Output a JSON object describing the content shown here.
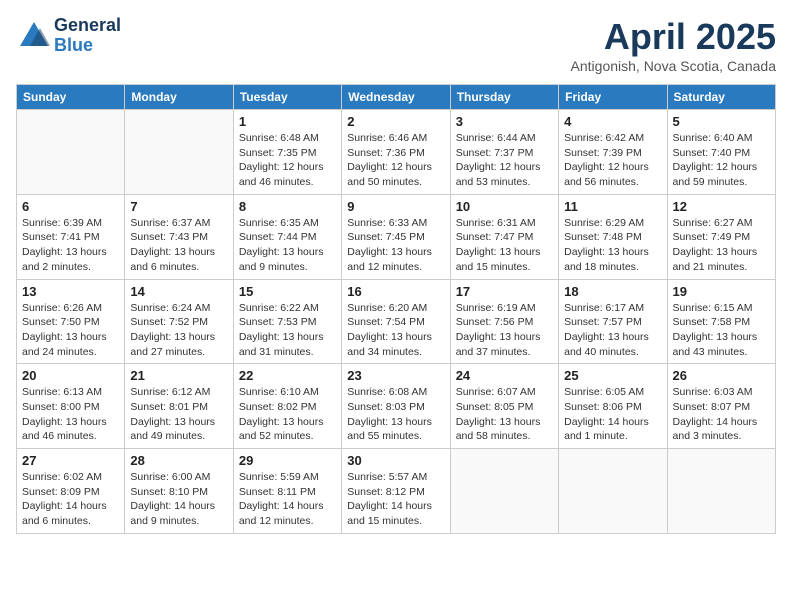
{
  "header": {
    "logo_general": "General",
    "logo_blue": "Blue",
    "month_year": "April 2025",
    "location": "Antigonish, Nova Scotia, Canada"
  },
  "weekdays": [
    "Sunday",
    "Monday",
    "Tuesday",
    "Wednesday",
    "Thursday",
    "Friday",
    "Saturday"
  ],
  "weeks": [
    [
      {
        "day": "",
        "info": ""
      },
      {
        "day": "",
        "info": ""
      },
      {
        "day": "1",
        "info": "Sunrise: 6:48 AM\nSunset: 7:35 PM\nDaylight: 12 hours and 46 minutes."
      },
      {
        "day": "2",
        "info": "Sunrise: 6:46 AM\nSunset: 7:36 PM\nDaylight: 12 hours and 50 minutes."
      },
      {
        "day": "3",
        "info": "Sunrise: 6:44 AM\nSunset: 7:37 PM\nDaylight: 12 hours and 53 minutes."
      },
      {
        "day": "4",
        "info": "Sunrise: 6:42 AM\nSunset: 7:39 PM\nDaylight: 12 hours and 56 minutes."
      },
      {
        "day": "5",
        "info": "Sunrise: 6:40 AM\nSunset: 7:40 PM\nDaylight: 12 hours and 59 minutes."
      }
    ],
    [
      {
        "day": "6",
        "info": "Sunrise: 6:39 AM\nSunset: 7:41 PM\nDaylight: 13 hours and 2 minutes."
      },
      {
        "day": "7",
        "info": "Sunrise: 6:37 AM\nSunset: 7:43 PM\nDaylight: 13 hours and 6 minutes."
      },
      {
        "day": "8",
        "info": "Sunrise: 6:35 AM\nSunset: 7:44 PM\nDaylight: 13 hours and 9 minutes."
      },
      {
        "day": "9",
        "info": "Sunrise: 6:33 AM\nSunset: 7:45 PM\nDaylight: 13 hours and 12 minutes."
      },
      {
        "day": "10",
        "info": "Sunrise: 6:31 AM\nSunset: 7:47 PM\nDaylight: 13 hours and 15 minutes."
      },
      {
        "day": "11",
        "info": "Sunrise: 6:29 AM\nSunset: 7:48 PM\nDaylight: 13 hours and 18 minutes."
      },
      {
        "day": "12",
        "info": "Sunrise: 6:27 AM\nSunset: 7:49 PM\nDaylight: 13 hours and 21 minutes."
      }
    ],
    [
      {
        "day": "13",
        "info": "Sunrise: 6:26 AM\nSunset: 7:50 PM\nDaylight: 13 hours and 24 minutes."
      },
      {
        "day": "14",
        "info": "Sunrise: 6:24 AM\nSunset: 7:52 PM\nDaylight: 13 hours and 27 minutes."
      },
      {
        "day": "15",
        "info": "Sunrise: 6:22 AM\nSunset: 7:53 PM\nDaylight: 13 hours and 31 minutes."
      },
      {
        "day": "16",
        "info": "Sunrise: 6:20 AM\nSunset: 7:54 PM\nDaylight: 13 hours and 34 minutes."
      },
      {
        "day": "17",
        "info": "Sunrise: 6:19 AM\nSunset: 7:56 PM\nDaylight: 13 hours and 37 minutes."
      },
      {
        "day": "18",
        "info": "Sunrise: 6:17 AM\nSunset: 7:57 PM\nDaylight: 13 hours and 40 minutes."
      },
      {
        "day": "19",
        "info": "Sunrise: 6:15 AM\nSunset: 7:58 PM\nDaylight: 13 hours and 43 minutes."
      }
    ],
    [
      {
        "day": "20",
        "info": "Sunrise: 6:13 AM\nSunset: 8:00 PM\nDaylight: 13 hours and 46 minutes."
      },
      {
        "day": "21",
        "info": "Sunrise: 6:12 AM\nSunset: 8:01 PM\nDaylight: 13 hours and 49 minutes."
      },
      {
        "day": "22",
        "info": "Sunrise: 6:10 AM\nSunset: 8:02 PM\nDaylight: 13 hours and 52 minutes."
      },
      {
        "day": "23",
        "info": "Sunrise: 6:08 AM\nSunset: 8:03 PM\nDaylight: 13 hours and 55 minutes."
      },
      {
        "day": "24",
        "info": "Sunrise: 6:07 AM\nSunset: 8:05 PM\nDaylight: 13 hours and 58 minutes."
      },
      {
        "day": "25",
        "info": "Sunrise: 6:05 AM\nSunset: 8:06 PM\nDaylight: 14 hours and 1 minute."
      },
      {
        "day": "26",
        "info": "Sunrise: 6:03 AM\nSunset: 8:07 PM\nDaylight: 14 hours and 3 minutes."
      }
    ],
    [
      {
        "day": "27",
        "info": "Sunrise: 6:02 AM\nSunset: 8:09 PM\nDaylight: 14 hours and 6 minutes."
      },
      {
        "day": "28",
        "info": "Sunrise: 6:00 AM\nSunset: 8:10 PM\nDaylight: 14 hours and 9 minutes."
      },
      {
        "day": "29",
        "info": "Sunrise: 5:59 AM\nSunset: 8:11 PM\nDaylight: 14 hours and 12 minutes."
      },
      {
        "day": "30",
        "info": "Sunrise: 5:57 AM\nSunset: 8:12 PM\nDaylight: 14 hours and 15 minutes."
      },
      {
        "day": "",
        "info": ""
      },
      {
        "day": "",
        "info": ""
      },
      {
        "day": "",
        "info": ""
      }
    ]
  ]
}
